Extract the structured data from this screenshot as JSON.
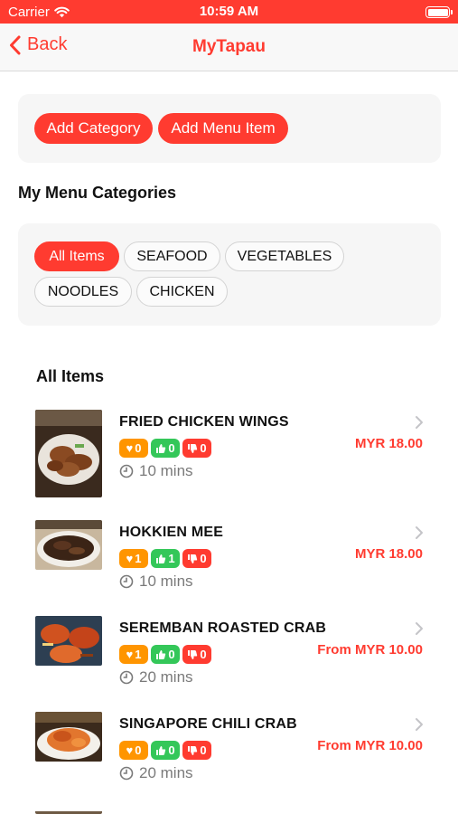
{
  "status_bar": {
    "carrier": "Carrier",
    "time": "10:59 AM"
  },
  "nav": {
    "back_label": "Back",
    "title": "MyTapau"
  },
  "actions": {
    "add_category": "Add Category",
    "add_menu_item": "Add Menu Item"
  },
  "categories_section": {
    "title": "My Menu Categories",
    "chips": [
      "All Items",
      "SEAFOOD",
      "VEGETABLES",
      "NOODLES",
      "CHICKEN"
    ],
    "selected": "All Items"
  },
  "items_section": {
    "title": "All Items",
    "items": [
      {
        "name": "FRIED CHICKEN WINGS",
        "price": "MYR 18.00",
        "love": "0",
        "like": "0",
        "dislike": "0",
        "prep_time": "10 mins"
      },
      {
        "name": "HOKKIEN MEE",
        "price": "MYR 18.00",
        "love": "1",
        "like": "1",
        "dislike": "0",
        "prep_time": "10 mins"
      },
      {
        "name": "SEREMBAN ROASTED CRAB",
        "price": "From MYR 10.00",
        "love": "1",
        "like": "0",
        "dislike": "0",
        "prep_time": "20 mins"
      },
      {
        "name": "SINGAPORE CHILI CRAB",
        "price": "From MYR 10.00",
        "love": "0",
        "like": "0",
        "dislike": "0",
        "prep_time": "20 mins"
      }
    ]
  },
  "colors": {
    "accent": "#ff3b30",
    "love": "#ff9500",
    "like": "#34c759",
    "dislike": "#ff3b30",
    "muted": "#7a7a7a"
  }
}
